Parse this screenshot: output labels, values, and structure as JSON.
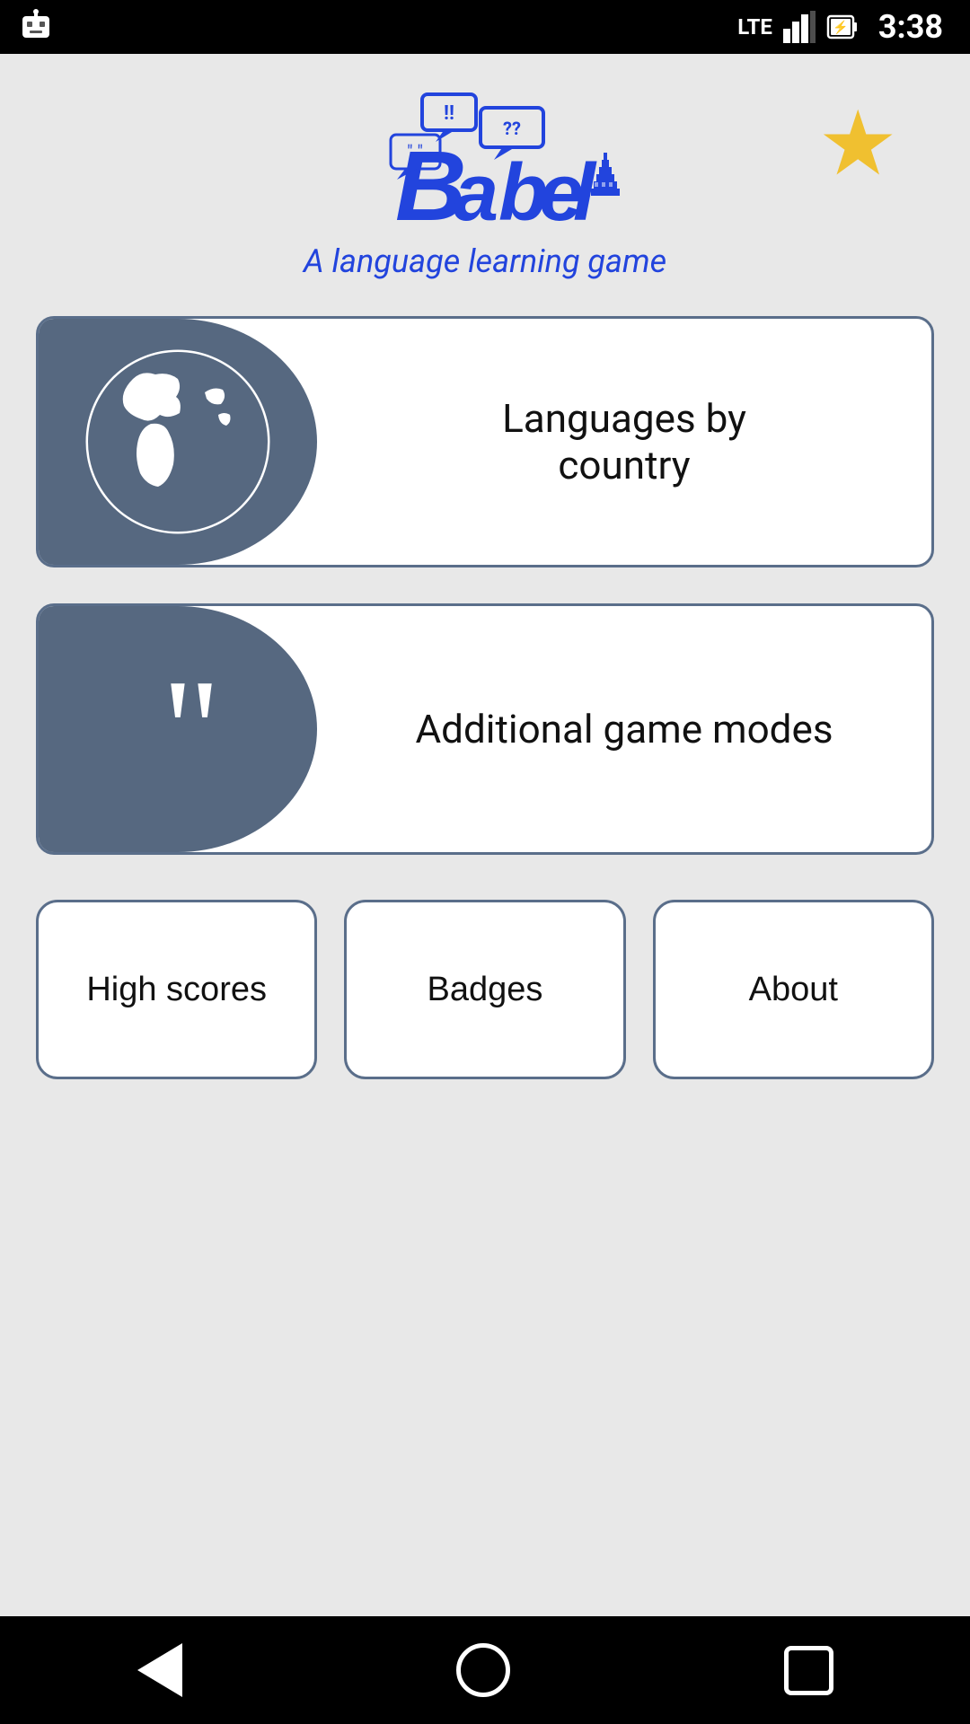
{
  "statusBar": {
    "time": "3:38",
    "signal": "LTE",
    "battery": "⚡"
  },
  "header": {
    "logoAlt": "Babel - A language learning game logo",
    "subtitle": "A language learning game",
    "starLabel": "★"
  },
  "gameModes": [
    {
      "id": "languages-by-country",
      "label": "Languages by\ncountry",
      "iconType": "globe"
    },
    {
      "id": "additional-game-modes",
      "label": "Additional game modes",
      "iconType": "quotes"
    }
  ],
  "bottomButtons": [
    {
      "id": "high-scores",
      "label": "High scores"
    },
    {
      "id": "badges",
      "label": "Badges"
    },
    {
      "id": "about",
      "label": "About"
    }
  ],
  "navBar": {
    "backLabel": "back",
    "homeLabel": "home",
    "recentsLabel": "recents"
  }
}
